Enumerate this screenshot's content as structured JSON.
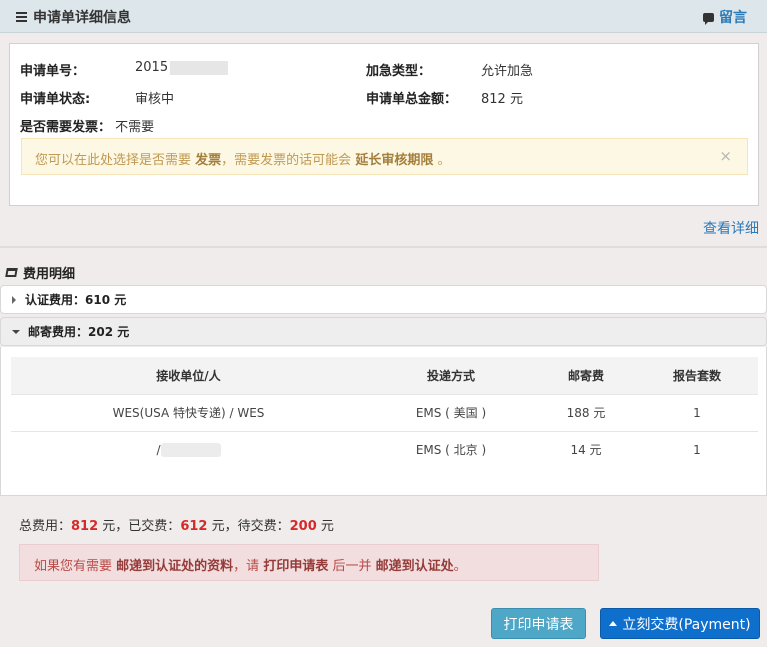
{
  "header": {
    "title": "申请单详细信息",
    "message_link": "留言"
  },
  "info": {
    "app_no_label": "申请单号：",
    "app_no_value": "2015",
    "urgent_label": "加急类型：",
    "urgent_value": "允许加急",
    "status_label": "申请单状态:",
    "status_value": "审核中",
    "total_label": "申请单总金额：",
    "total_value": "812 元",
    "invoice_label": "是否需要发票：",
    "invoice_value": "不需要"
  },
  "invoice_alert": {
    "text1": "您可以在此处选择是否需要",
    "bold1": "发票",
    "text2": "，需要发票的话可能会",
    "bold2": "延长审核期限",
    "text3": "。",
    "close": "×"
  },
  "view_detail": "查看详细",
  "fees": {
    "title": "费用明细",
    "cert_fee": "认证费用：610 元",
    "mail_fee": "邮寄费用：202 元",
    "table": {
      "headers": [
        "接收单位/人",
        "投递方式",
        "邮寄费",
        "报告套数"
      ],
      "rows": [
        [
          "WES(USA 特快专递) / WES",
          "EMS ( 美国 )",
          "188 元",
          "1"
        ],
        [
          "/",
          "EMS ( 北京 )",
          "14 元",
          "1"
        ]
      ]
    }
  },
  "totals": {
    "label_total": "总费用：",
    "total": "812",
    "unit1": " 元，",
    "label_paid": "已交费：",
    "paid": "612",
    "unit2": " 元，",
    "label_due": "待交费：",
    "due": "200",
    "unit3": " 元"
  },
  "mail_alert": {
    "text1": "如果您有需要",
    "bold1": "邮递到认证处的资料",
    "text2": "，请",
    "bold2": "打印申请表",
    "text3": "后一并",
    "bold3": "邮递到认证处",
    "text4": "。"
  },
  "buttons": {
    "print": "打印申请表",
    "pay": "立刻交费(Payment)"
  }
}
